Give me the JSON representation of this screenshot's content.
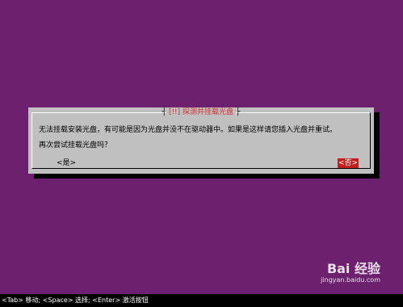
{
  "dialog": {
    "title_left_edge": "┤",
    "title": "[!!] 探测并挂载光盘",
    "title_right_edge": "├",
    "message": "无法挂载安装光盘，有可能是因为光盘并没不在驱动器中。如果是这样请您插入光盘并重试。",
    "question": "再次尝试挂载光盘吗？",
    "yes_label": "<是>",
    "no_label": "<否>"
  },
  "status_bar": {
    "text": "<Tab> 移动; <Space> 选择; <Enter> 激活按钮"
  },
  "watermark": {
    "brand": "Bai 经验",
    "paw": "🐾",
    "url": "jingyan.baidu.com"
  },
  "colors": {
    "background": "#6d206d",
    "dialog": "#c0c0c0",
    "title_accent": "#d03030",
    "selected_button": "#c02020",
    "status_bar": "#000000"
  }
}
